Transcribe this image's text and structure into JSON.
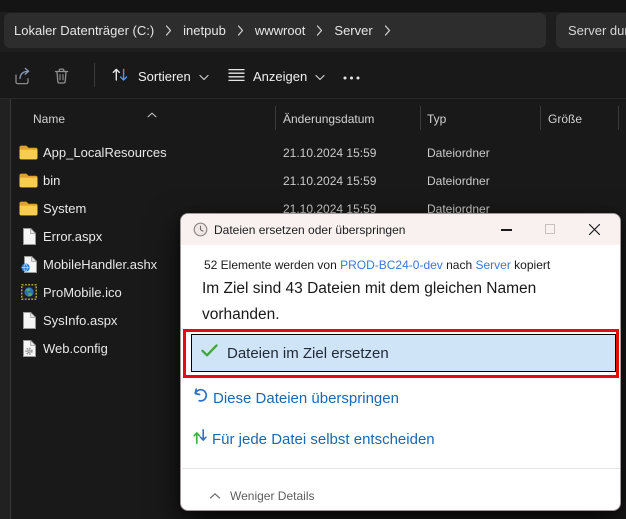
{
  "colors": {
    "accent_link": "#3d77cf",
    "option_link": "#1a67b2",
    "annotation_red": "#e60c0c",
    "selected_option_bg": "#cfe4f7",
    "folder_yellow": "#f7cc4f",
    "window_bg_dark": "#191919",
    "dialog_titlebar": "#f8f1f0"
  },
  "breadcrumb": {
    "items": [
      "Lokaler Datenträger (C:)",
      "inetpub",
      "wwwroot",
      "Server"
    ]
  },
  "search": {
    "value": "Server dur"
  },
  "toolbar": {
    "sort_label": "Sortieren",
    "view_label": "Anzeigen",
    "icons": [
      "share-icon",
      "delete-icon",
      "sort-arrows-icon",
      "chevron-down-icon",
      "view-lines-icon",
      "more-dots-icon"
    ]
  },
  "columns": {
    "name": "Name",
    "modified": "Änderungsdatum",
    "type": "Typ",
    "size": "Größe"
  },
  "files": {
    "rows": [
      {
        "icon": "folder-icon",
        "name": "App_LocalResources",
        "modified": "21.10.2024 15:59",
        "type": "Dateiordner",
        "size": ""
      },
      {
        "icon": "folder-icon",
        "name": "bin",
        "modified": "21.10.2024 15:59",
        "type": "Dateiordner",
        "size": ""
      },
      {
        "icon": "folder-icon",
        "name": "System",
        "modified": "21.10.2024 15:59",
        "type": "Dateiordner",
        "size": ""
      },
      {
        "icon": "file-icon",
        "name": "Error.aspx",
        "modified": "",
        "type": "",
        "size": ""
      },
      {
        "icon": "file-globe-icon",
        "name": "MobileHandler.ashx",
        "modified": "",
        "type": "",
        "size": ""
      },
      {
        "icon": "ico-file-icon",
        "name": "ProMobile.ico",
        "modified": "",
        "type": "",
        "size": ""
      },
      {
        "icon": "file-icon",
        "name": "SysInfo.aspx",
        "modified": "",
        "type": "",
        "size": ""
      },
      {
        "icon": "file-gear-icon",
        "name": "Web.config",
        "modified": "",
        "type": "",
        "size": ""
      }
    ]
  },
  "dialog": {
    "title": "Dateien ersetzen oder überspringen",
    "copy_line": {
      "prefix": "52 Elemente werden von ",
      "source": "PROD-BC24-0-dev",
      "middle": " nach ",
      "target": "Server",
      "suffix": " kopiert"
    },
    "message": "Im Ziel sind 43 Dateien mit dem gleichen Namen vorhanden.",
    "options": [
      {
        "icon": "check-icon",
        "label": "Dateien im Ziel ersetzen"
      },
      {
        "icon": "skip-icon",
        "label": "Diese Dateien überspringen"
      },
      {
        "icon": "decide-icon",
        "label": "Für jede Datei selbst entscheiden"
      }
    ],
    "footer_label": "Weniger Details"
  }
}
